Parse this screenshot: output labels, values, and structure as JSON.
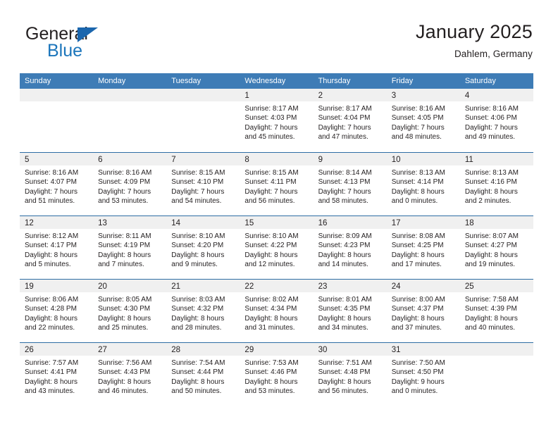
{
  "logo": {
    "word1": "General",
    "word2": "Blue",
    "triangle_color": "#1b66ad",
    "blue_color": "#1b75bb"
  },
  "header": {
    "title": "January 2025",
    "subtitle": "Dahlem, Germany",
    "header_bg": "#3e7cb6",
    "row_border": "#2e6da4",
    "band_bg": "#f0f0f0"
  },
  "weekdays": [
    "Sunday",
    "Monday",
    "Tuesday",
    "Wednesday",
    "Thursday",
    "Friday",
    "Saturday"
  ],
  "weeks": [
    [
      {
        "empty": true
      },
      {
        "empty": true
      },
      {
        "empty": true
      },
      {
        "day": "1",
        "sunrise": "Sunrise: 8:17 AM",
        "sunset": "Sunset: 4:03 PM",
        "daylight1": "Daylight: 7 hours",
        "daylight2": "and 45 minutes."
      },
      {
        "day": "2",
        "sunrise": "Sunrise: 8:17 AM",
        "sunset": "Sunset: 4:04 PM",
        "daylight1": "Daylight: 7 hours",
        "daylight2": "and 47 minutes."
      },
      {
        "day": "3",
        "sunrise": "Sunrise: 8:16 AM",
        "sunset": "Sunset: 4:05 PM",
        "daylight1": "Daylight: 7 hours",
        "daylight2": "and 48 minutes."
      },
      {
        "day": "4",
        "sunrise": "Sunrise: 8:16 AM",
        "sunset": "Sunset: 4:06 PM",
        "daylight1": "Daylight: 7 hours",
        "daylight2": "and 49 minutes."
      }
    ],
    [
      {
        "day": "5",
        "sunrise": "Sunrise: 8:16 AM",
        "sunset": "Sunset: 4:07 PM",
        "daylight1": "Daylight: 7 hours",
        "daylight2": "and 51 minutes."
      },
      {
        "day": "6",
        "sunrise": "Sunrise: 8:16 AM",
        "sunset": "Sunset: 4:09 PM",
        "daylight1": "Daylight: 7 hours",
        "daylight2": "and 53 minutes."
      },
      {
        "day": "7",
        "sunrise": "Sunrise: 8:15 AM",
        "sunset": "Sunset: 4:10 PM",
        "daylight1": "Daylight: 7 hours",
        "daylight2": "and 54 minutes."
      },
      {
        "day": "8",
        "sunrise": "Sunrise: 8:15 AM",
        "sunset": "Sunset: 4:11 PM",
        "daylight1": "Daylight: 7 hours",
        "daylight2": "and 56 minutes."
      },
      {
        "day": "9",
        "sunrise": "Sunrise: 8:14 AM",
        "sunset": "Sunset: 4:13 PM",
        "daylight1": "Daylight: 7 hours",
        "daylight2": "and 58 minutes."
      },
      {
        "day": "10",
        "sunrise": "Sunrise: 8:13 AM",
        "sunset": "Sunset: 4:14 PM",
        "daylight1": "Daylight: 8 hours",
        "daylight2": "and 0 minutes."
      },
      {
        "day": "11",
        "sunrise": "Sunrise: 8:13 AM",
        "sunset": "Sunset: 4:16 PM",
        "daylight1": "Daylight: 8 hours",
        "daylight2": "and 2 minutes."
      }
    ],
    [
      {
        "day": "12",
        "sunrise": "Sunrise: 8:12 AM",
        "sunset": "Sunset: 4:17 PM",
        "daylight1": "Daylight: 8 hours",
        "daylight2": "and 5 minutes."
      },
      {
        "day": "13",
        "sunrise": "Sunrise: 8:11 AM",
        "sunset": "Sunset: 4:19 PM",
        "daylight1": "Daylight: 8 hours",
        "daylight2": "and 7 minutes."
      },
      {
        "day": "14",
        "sunrise": "Sunrise: 8:10 AM",
        "sunset": "Sunset: 4:20 PM",
        "daylight1": "Daylight: 8 hours",
        "daylight2": "and 9 minutes."
      },
      {
        "day": "15",
        "sunrise": "Sunrise: 8:10 AM",
        "sunset": "Sunset: 4:22 PM",
        "daylight1": "Daylight: 8 hours",
        "daylight2": "and 12 minutes."
      },
      {
        "day": "16",
        "sunrise": "Sunrise: 8:09 AM",
        "sunset": "Sunset: 4:23 PM",
        "daylight1": "Daylight: 8 hours",
        "daylight2": "and 14 minutes."
      },
      {
        "day": "17",
        "sunrise": "Sunrise: 8:08 AM",
        "sunset": "Sunset: 4:25 PM",
        "daylight1": "Daylight: 8 hours",
        "daylight2": "and 17 minutes."
      },
      {
        "day": "18",
        "sunrise": "Sunrise: 8:07 AM",
        "sunset": "Sunset: 4:27 PM",
        "daylight1": "Daylight: 8 hours",
        "daylight2": "and 19 minutes."
      }
    ],
    [
      {
        "day": "19",
        "sunrise": "Sunrise: 8:06 AM",
        "sunset": "Sunset: 4:28 PM",
        "daylight1": "Daylight: 8 hours",
        "daylight2": "and 22 minutes."
      },
      {
        "day": "20",
        "sunrise": "Sunrise: 8:05 AM",
        "sunset": "Sunset: 4:30 PM",
        "daylight1": "Daylight: 8 hours",
        "daylight2": "and 25 minutes."
      },
      {
        "day": "21",
        "sunrise": "Sunrise: 8:03 AM",
        "sunset": "Sunset: 4:32 PM",
        "daylight1": "Daylight: 8 hours",
        "daylight2": "and 28 minutes."
      },
      {
        "day": "22",
        "sunrise": "Sunrise: 8:02 AM",
        "sunset": "Sunset: 4:34 PM",
        "daylight1": "Daylight: 8 hours",
        "daylight2": "and 31 minutes."
      },
      {
        "day": "23",
        "sunrise": "Sunrise: 8:01 AM",
        "sunset": "Sunset: 4:35 PM",
        "daylight1": "Daylight: 8 hours",
        "daylight2": "and 34 minutes."
      },
      {
        "day": "24",
        "sunrise": "Sunrise: 8:00 AM",
        "sunset": "Sunset: 4:37 PM",
        "daylight1": "Daylight: 8 hours",
        "daylight2": "and 37 minutes."
      },
      {
        "day": "25",
        "sunrise": "Sunrise: 7:58 AM",
        "sunset": "Sunset: 4:39 PM",
        "daylight1": "Daylight: 8 hours",
        "daylight2": "and 40 minutes."
      }
    ],
    [
      {
        "day": "26",
        "sunrise": "Sunrise: 7:57 AM",
        "sunset": "Sunset: 4:41 PM",
        "daylight1": "Daylight: 8 hours",
        "daylight2": "and 43 minutes."
      },
      {
        "day": "27",
        "sunrise": "Sunrise: 7:56 AM",
        "sunset": "Sunset: 4:43 PM",
        "daylight1": "Daylight: 8 hours",
        "daylight2": "and 46 minutes."
      },
      {
        "day": "28",
        "sunrise": "Sunrise: 7:54 AM",
        "sunset": "Sunset: 4:44 PM",
        "daylight1": "Daylight: 8 hours",
        "daylight2": "and 50 minutes."
      },
      {
        "day": "29",
        "sunrise": "Sunrise: 7:53 AM",
        "sunset": "Sunset: 4:46 PM",
        "daylight1": "Daylight: 8 hours",
        "daylight2": "and 53 minutes."
      },
      {
        "day": "30",
        "sunrise": "Sunrise: 7:51 AM",
        "sunset": "Sunset: 4:48 PM",
        "daylight1": "Daylight: 8 hours",
        "daylight2": "and 56 minutes."
      },
      {
        "day": "31",
        "sunrise": "Sunrise: 7:50 AM",
        "sunset": "Sunset: 4:50 PM",
        "daylight1": "Daylight: 9 hours",
        "daylight2": "and 0 minutes."
      },
      {
        "empty": true
      }
    ]
  ]
}
